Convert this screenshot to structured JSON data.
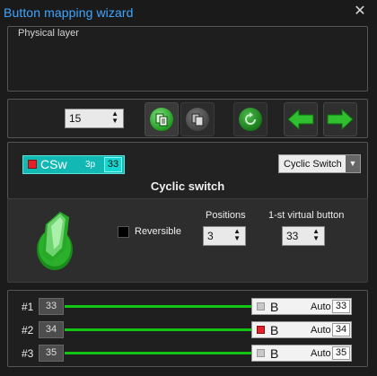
{
  "window": {
    "title": "Button mapping wizard",
    "close_glyph": "✕"
  },
  "physical_layer": {
    "label": "Physical layer"
  },
  "toolbar": {
    "number_value": "15",
    "buttons": [
      {
        "name": "copy-button",
        "icon": "copy-icon"
      },
      {
        "name": "paste-button",
        "icon": "paste-icon"
      },
      {
        "name": "refresh-button",
        "icon": "refresh-icon"
      },
      {
        "name": "prev-button",
        "icon": "arrow-left-icon"
      },
      {
        "name": "next-button",
        "icon": "arrow-right-icon"
      }
    ]
  },
  "control": {
    "name_code": "CSw",
    "positions_code": "3p",
    "number": "33",
    "type_select_value": "Cyclic Switch",
    "heading": "Cyclic switch"
  },
  "settings": {
    "reversible_label": "Reversible",
    "reversible_checked": false,
    "positions_label": "Positions",
    "positions_value": "3",
    "first_vb_label": "1-st virtual button",
    "first_vb_value": "33"
  },
  "mapping_rows": [
    {
      "label": "#1",
      "input": "33",
      "output_type": "B",
      "mode": "Auto",
      "output_number": "33",
      "indicator": "#c8c8c8"
    },
    {
      "label": "#2",
      "input": "34",
      "output_type": "B",
      "mode": "Auto",
      "output_number": "34",
      "indicator": "#e0222a"
    },
    {
      "label": "#3",
      "input": "35",
      "output_type": "B",
      "mode": "Auto",
      "output_number": "35",
      "indicator": "#c8c8c8"
    }
  ],
  "colors": {
    "title": "#3fa6ff",
    "accent_cyan": "#12b9b4",
    "accent_green": "#14c414",
    "status_red": "#e0222a"
  }
}
